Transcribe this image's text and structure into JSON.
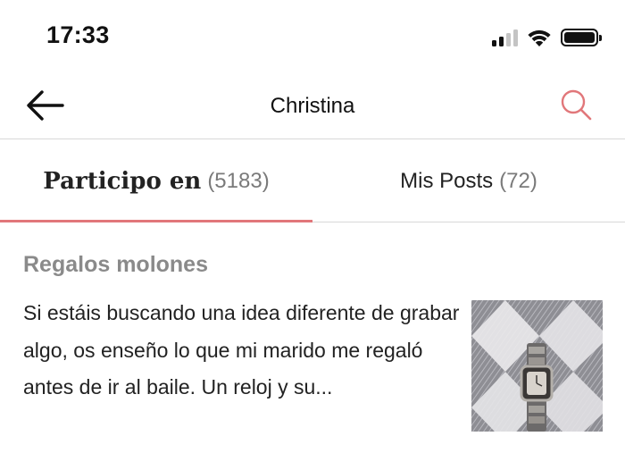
{
  "status_bar": {
    "time": "17:33",
    "signal_icon": "cellular-signal-icon",
    "wifi_icon": "wifi-icon",
    "battery_icon": "battery-icon"
  },
  "header": {
    "title": "Christina",
    "back_icon": "arrow-left-icon",
    "search_icon": "search-icon",
    "accent_color": "#e1777a"
  },
  "tabs": [
    {
      "label": "Participo en",
      "count": "(5183)",
      "active": true
    },
    {
      "label": "Mis Posts",
      "count": "(72)",
      "active": false
    }
  ],
  "post": {
    "title": "Regalos molones",
    "excerpt": "Si estáis buscando una idea diferente de grabar algo, os enseño lo que mi marido me regaló antes de ir al baile. Un reloj y su...",
    "thumbnail": "wristwatch-photo"
  }
}
